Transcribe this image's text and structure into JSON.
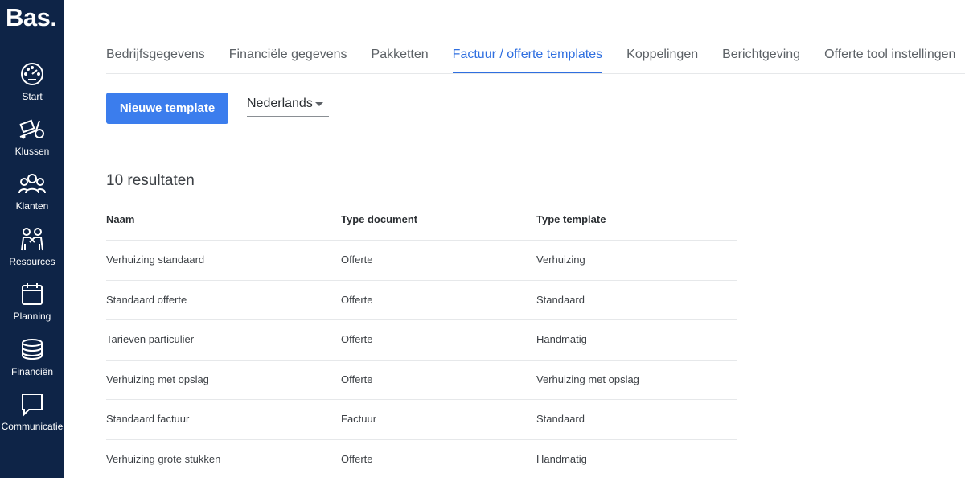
{
  "app": {
    "logo": "Bas."
  },
  "sidebar": {
    "items": [
      {
        "label": "Start",
        "icon": "dashboard-gauge-icon"
      },
      {
        "label": "Klussen",
        "icon": "moving-dolly-icon"
      },
      {
        "label": "Klanten",
        "icon": "customers-group-icon"
      },
      {
        "label": "Resources",
        "icon": "workers-icon"
      },
      {
        "label": "Planning",
        "icon": "calendar-icon"
      },
      {
        "label": "Financiën",
        "icon": "coins-stack-icon"
      },
      {
        "label": "Communicatie",
        "icon": "chat-bubble-icon"
      }
    ]
  },
  "tabs": [
    {
      "label": "Bedrijfsgegevens",
      "active": false
    },
    {
      "label": "Financiële gegevens",
      "active": false
    },
    {
      "label": "Pakketten",
      "active": false
    },
    {
      "label": "Factuur / offerte templates",
      "active": true
    },
    {
      "label": "Koppelingen",
      "active": false
    },
    {
      "label": "Berichtgeving",
      "active": false
    },
    {
      "label": "Offerte tool instellingen",
      "active": false
    }
  ],
  "toolbar": {
    "new_template_label": "Nieuwe template",
    "language_value": "Nederlands"
  },
  "results": {
    "count_label": "10 resultaten"
  },
  "table": {
    "headers": [
      "Naam",
      "Type document",
      "Type template"
    ],
    "rows": [
      [
        "Verhuizing standaard",
        "Offerte",
        "Verhuizing"
      ],
      [
        "Standaard offerte",
        "Offerte",
        "Standaard"
      ],
      [
        "Tarieven particulier",
        "Offerte",
        "Handmatig"
      ],
      [
        "Verhuizing met opslag",
        "Offerte",
        "Verhuizing met opslag"
      ],
      [
        "Standaard factuur",
        "Factuur",
        "Standaard"
      ],
      [
        "Verhuizing grote stukken",
        "Offerte",
        "Handmatig"
      ]
    ]
  },
  "colors": {
    "sidebar_bg": "#0e2447",
    "accent": "#2f6fe0",
    "button_bg": "#3b7ded"
  }
}
